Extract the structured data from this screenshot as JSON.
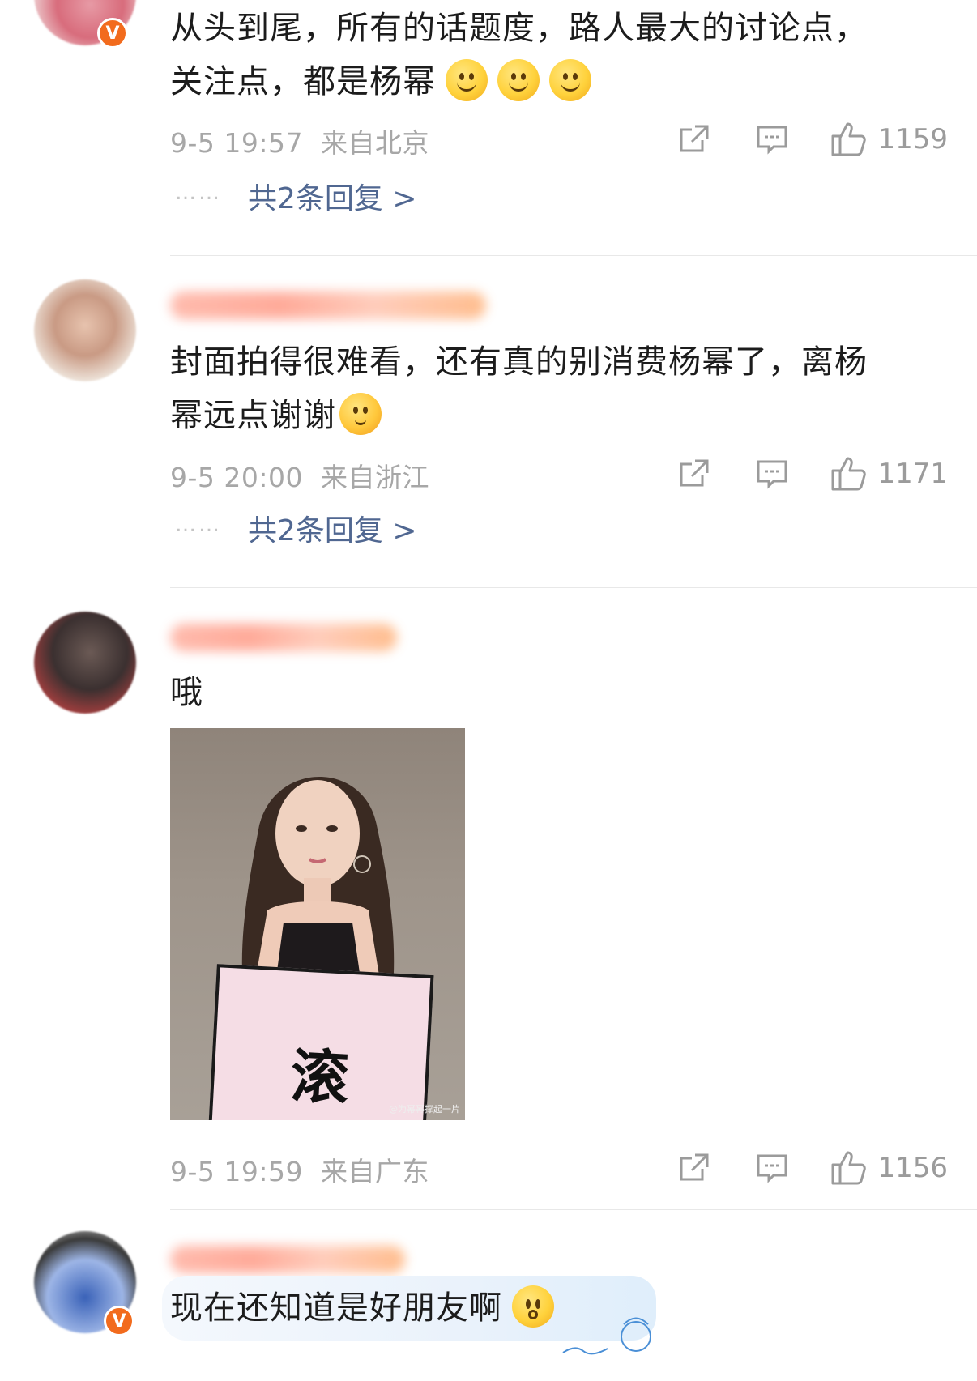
{
  "comments": [
    {
      "text_line1": "从头到尾，所有的话题度，路人最大的讨论点，",
      "text_line2": "关注点，都是杨幂",
      "emojis": [
        "smile-emoji",
        "smile-emoji",
        "smile-emoji"
      ],
      "date": "9-5 19:57",
      "location": "来自北京",
      "likes": "1159",
      "replies": "共2条回复 >",
      "verified": true
    },
    {
      "text_line1": "封面拍得很难看，还有真的别消费杨幂了，离杨",
      "text_line2": "幂远点谢谢",
      "emojis": [
        "blush-emoji"
      ],
      "date": "9-5 20:00",
      "location": "来自浙江",
      "likes": "1171",
      "replies": "共2条回复 >",
      "verified": false
    },
    {
      "text_line1": "哦",
      "image_sign_text": "滚",
      "image_watermark": "@为幂幂撑起一片",
      "date": "9-5 19:59",
      "location": "来自广东",
      "likes": "1156",
      "verified": false
    },
    {
      "text_line1": "现在还知道是好朋友啊",
      "emojis": [
        "shocked-emoji"
      ],
      "verified": true
    }
  ],
  "dots": "……",
  "badge": "V",
  "colors": {
    "reply_link": "#506791",
    "meta": "#a7a7a7",
    "badge": "#f26b1d"
  }
}
